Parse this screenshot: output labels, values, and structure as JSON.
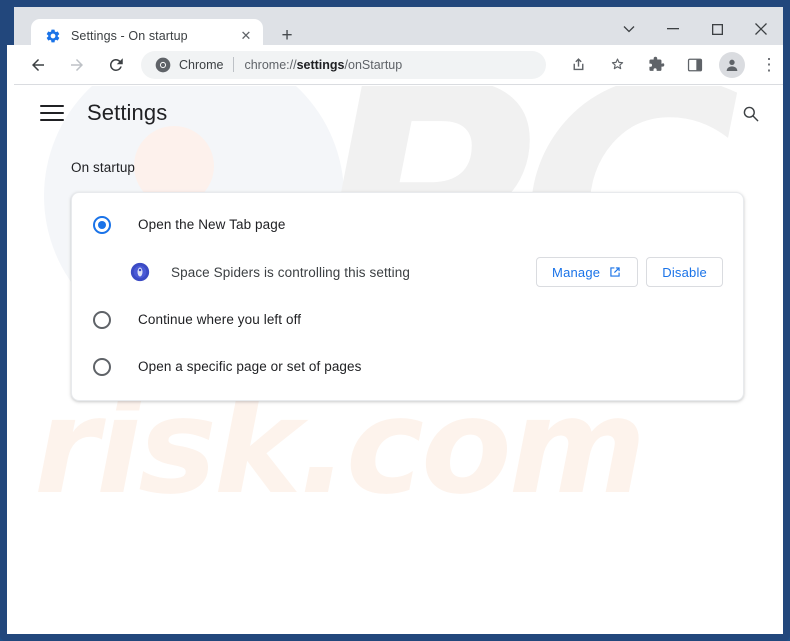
{
  "window": {
    "controls": {
      "more_tabs": "search-tabs-chevron",
      "minimize": "─",
      "maximize": "□",
      "close": "✕"
    }
  },
  "tabstrip": {
    "tabs": [
      {
        "title": "Settings - On startup",
        "favicon": "gear-icon",
        "close_label": "✕",
        "active": true
      }
    ],
    "new_tab_label": "+"
  },
  "toolbar": {
    "back_label": "←",
    "forward_label": "→",
    "reload_label": "⟳",
    "omnibox": {
      "chip_label": "Chrome",
      "url_prefix": "chrome://",
      "url_bold": "settings",
      "url_suffix": "/onStartup"
    },
    "share_label": "share-icon",
    "bookmark_label": "star-icon",
    "extensions_label": "puzzle-icon",
    "sidepanel_label": "side-panel-icon",
    "profile_label": "profile-avatar-icon",
    "menu_label": "⋮"
  },
  "settings": {
    "title": "Settings",
    "menu_icon": "hamburger-icon",
    "search_icon": "search-icon",
    "section_label": "On startup",
    "options": [
      {
        "label": "Open the New Tab page",
        "checked": true
      },
      {
        "label": "Continue where you left off",
        "checked": false
      },
      {
        "label": "Open a specific page or set of pages",
        "checked": false
      }
    ],
    "extension_notice": {
      "icon": "extension-icon",
      "text": "Space Spiders is controlling this setting",
      "manage_label": "Manage",
      "manage_icon": "open-in-new-icon",
      "disable_label": "Disable"
    }
  },
  "watermark": {
    "top_text": "PC",
    "bottom_text": "risk.com"
  },
  "colors": {
    "accent": "#1a73e8",
    "frame": "#22477c",
    "tabstrip": "#dee1e6",
    "text": "#202124",
    "muted": "#5f6368"
  }
}
